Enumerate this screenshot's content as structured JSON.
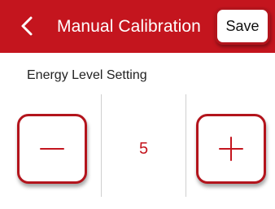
{
  "header": {
    "title": "Manual Calibration",
    "back_icon": "chevron-left-icon",
    "save_label": "Save"
  },
  "setting": {
    "label": "Energy Level Setting",
    "value": "5",
    "decrease_icon": "minus-icon",
    "increase_icon": "plus-icon"
  },
  "colors": {
    "accent": "#c4151e",
    "button_border": "#b3141c",
    "background": "#ffffff"
  }
}
